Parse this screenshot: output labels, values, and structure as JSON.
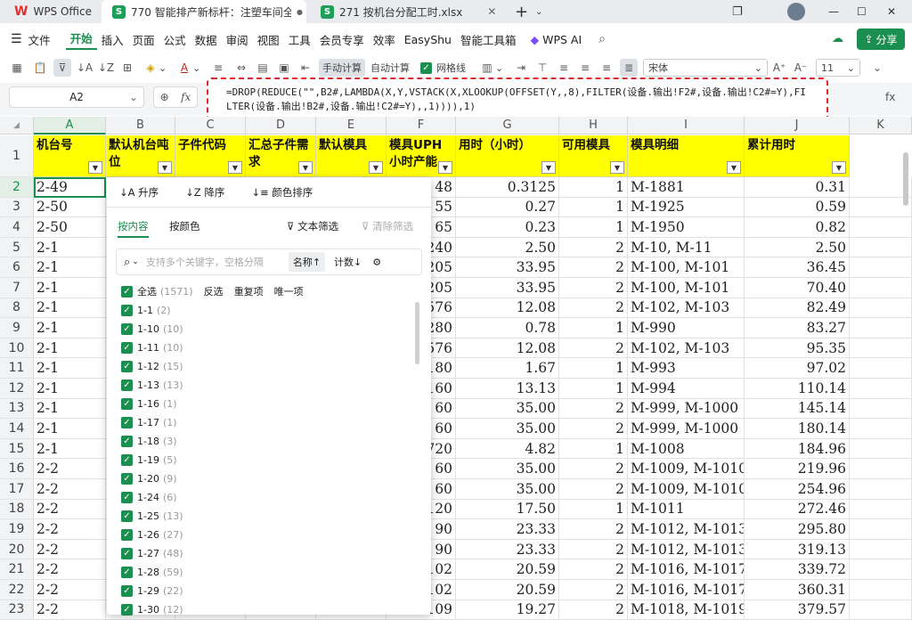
{
  "tabs": [
    {
      "label": "WPS Office",
      "icon": "wps-logo-icon"
    },
    {
      "label": "770 智能排产新标杆：注塑车间全",
      "icon": "sheet-icon"
    },
    {
      "label": "271 按机台分配工时.xlsx",
      "icon": "sheet-icon"
    }
  ],
  "menu": {
    "file": "文件",
    "items": [
      "开始",
      "插入",
      "页面",
      "公式",
      "数据",
      "审阅",
      "视图",
      "工具",
      "会员专享",
      "效率",
      "EasyShu",
      "智能工具箱"
    ],
    "wps_ai": "WPS AI",
    "share": "分享"
  },
  "toolbar": {
    "manual_calc": "手动计算",
    "auto_calc": "自动计算",
    "gridlines": "网格线",
    "font": "宋体",
    "font_size": "11"
  },
  "formula_bar": {
    "name_box": "A2",
    "fx": "fx",
    "formula": "=DROP(REDUCE(\"\",B2#,LAMBDA(X,Y,VSTACK(X,XLOOKUP(OFFSET(Y,,8),FILTER(设备.输出!F2#,设备.输出!C2#=Y),FILTER(设备.输出!B2#,设备.输出!C2#=Y),,1)))),1)"
  },
  "columns": [
    "A",
    "B",
    "C",
    "D",
    "E",
    "F",
    "G",
    "H",
    "I",
    "J",
    "K"
  ],
  "headers": [
    "机台号",
    "默认机台吨位",
    "子件代码",
    "汇总子件需求",
    "默认模具",
    "模具UPH小时产能",
    "用时（小时）",
    "可用模具",
    "模具明细",
    "累计用时"
  ],
  "rows": [
    {
      "r": "2",
      "a": "2-49",
      "f": "48",
      "g": "0.3125",
      "h": "1",
      "i": "M-1881",
      "j": "0.31"
    },
    {
      "r": "3",
      "a": "2-50",
      "f": "55",
      "g": "0.27",
      "h": "1",
      "i": "M-1925",
      "j": "0.59"
    },
    {
      "r": "4",
      "a": "2-50",
      "f": "65",
      "g": "0.23",
      "h": "1",
      "i": "M-1950",
      "j": "0.82"
    },
    {
      "r": "5",
      "a": "2-1",
      "f": "240",
      "g": "2.50",
      "h": "2",
      "i": "M-10, M-11",
      "j": "2.50"
    },
    {
      "r": "6",
      "a": "2-1",
      "f": "205",
      "g": "33.95",
      "h": "2",
      "i": "M-100, M-101",
      "j": "36.45"
    },
    {
      "r": "7",
      "a": "2-1",
      "f": "205",
      "g": "33.95",
      "h": "2",
      "i": "M-100, M-101",
      "j": "70.40"
    },
    {
      "r": "8",
      "a": "2-1",
      "f": "576",
      "g": "12.08",
      "h": "2",
      "i": "M-102, M-103",
      "j": "82.49"
    },
    {
      "r": "9",
      "a": "2-1",
      "f": "280",
      "g": "0.78",
      "h": "1",
      "i": "M-990",
      "j": "83.27"
    },
    {
      "r": "10",
      "a": "2-1",
      "f": "576",
      "g": "12.08",
      "h": "2",
      "i": "M-102, M-103",
      "j": "95.35"
    },
    {
      "r": "11",
      "a": "2-1",
      "f": "180",
      "g": "1.67",
      "h": "1",
      "i": "M-993",
      "j": "97.02"
    },
    {
      "r": "12",
      "a": "2-1",
      "f": "160",
      "g": "13.13",
      "h": "1",
      "i": "M-994",
      "j": "110.14"
    },
    {
      "r": "13",
      "a": "2-1",
      "f": "60",
      "g": "35.00",
      "h": "2",
      "i": "M-999, M-1000",
      "j": "145.14"
    },
    {
      "r": "14",
      "a": "2-1",
      "f": "60",
      "g": "35.00",
      "h": "2",
      "i": "M-999, M-1000",
      "j": "180.14"
    },
    {
      "r": "15",
      "a": "2-1",
      "f": "720",
      "g": "4.82",
      "h": "1",
      "i": "M-1008",
      "j": "184.96"
    },
    {
      "r": "16",
      "a": "2-2",
      "f": "60",
      "g": "35.00",
      "h": "2",
      "i": "M-1009, M-1010",
      "j": "219.96"
    },
    {
      "r": "17",
      "a": "2-2",
      "f": "60",
      "g": "35.00",
      "h": "2",
      "i": "M-1009, M-1010",
      "j": "254.96"
    },
    {
      "r": "18",
      "a": "2-2",
      "f": "120",
      "g": "17.50",
      "h": "1",
      "i": "M-1011",
      "j": "272.46"
    },
    {
      "r": "19",
      "a": "2-2",
      "f": "90",
      "g": "23.33",
      "h": "2",
      "i": "M-1012, M-1013",
      "j": "295.80"
    },
    {
      "r": "20",
      "a": "2-2",
      "f": "90",
      "g": "23.33",
      "h": "2",
      "i": "M-1012, M-1013",
      "j": "319.13"
    },
    {
      "r": "21",
      "a": "2-2",
      "f": "102",
      "g": "20.59",
      "h": "2",
      "i": "M-1016, M-1017",
      "j": "339.72"
    },
    {
      "r": "22",
      "a": "2-2",
      "f": "102",
      "g": "20.59",
      "h": "2",
      "i": "M-1016, M-1017",
      "j": "360.31"
    },
    {
      "r": "23",
      "a": "2-2",
      "f": "109",
      "g": "19.27",
      "h": "2",
      "i": "M-1018, M-1019",
      "j": "379.57"
    }
  ],
  "filter_panel": {
    "sort_asc": "升序",
    "sort_desc": "降序",
    "sort_color": "颜色排序",
    "tab_content": "按内容",
    "tab_color": "按颜色",
    "text_filter": "文本筛选",
    "clear_filter": "清除筛选",
    "search_placeholder": "支持多个关键字，空格分隔",
    "sort_name": "名称↑",
    "sort_count": "计数↓",
    "select_all": "全选",
    "select_all_count": "(1571)",
    "invert": "反选",
    "duplicates": "重复项",
    "unique": "唯一项",
    "items": [
      {
        "label": "1-1",
        "count": "(2)"
      },
      {
        "label": "1-10",
        "count": "(10)"
      },
      {
        "label": "1-11",
        "count": "(10)"
      },
      {
        "label": "1-12",
        "count": "(15)"
      },
      {
        "label": "1-13",
        "count": "(13)"
      },
      {
        "label": "1-16",
        "count": "(1)"
      },
      {
        "label": "1-17",
        "count": "(1)"
      },
      {
        "label": "1-18",
        "count": "(3)"
      },
      {
        "label": "1-19",
        "count": "(5)"
      },
      {
        "label": "1-20",
        "count": "(9)"
      },
      {
        "label": "1-24",
        "count": "(6)"
      },
      {
        "label": "1-25",
        "count": "(13)"
      },
      {
        "label": "1-26",
        "count": "(27)"
      },
      {
        "label": "1-27",
        "count": "(48)"
      },
      {
        "label": "1-28",
        "count": "(59)"
      },
      {
        "label": "1-29",
        "count": "(22)"
      },
      {
        "label": "1-30",
        "count": "(12)"
      }
    ]
  },
  "colors": {
    "accent": "#1a8f4f",
    "header_fill": "#ffff00",
    "highlight_border": "#e0262b"
  }
}
